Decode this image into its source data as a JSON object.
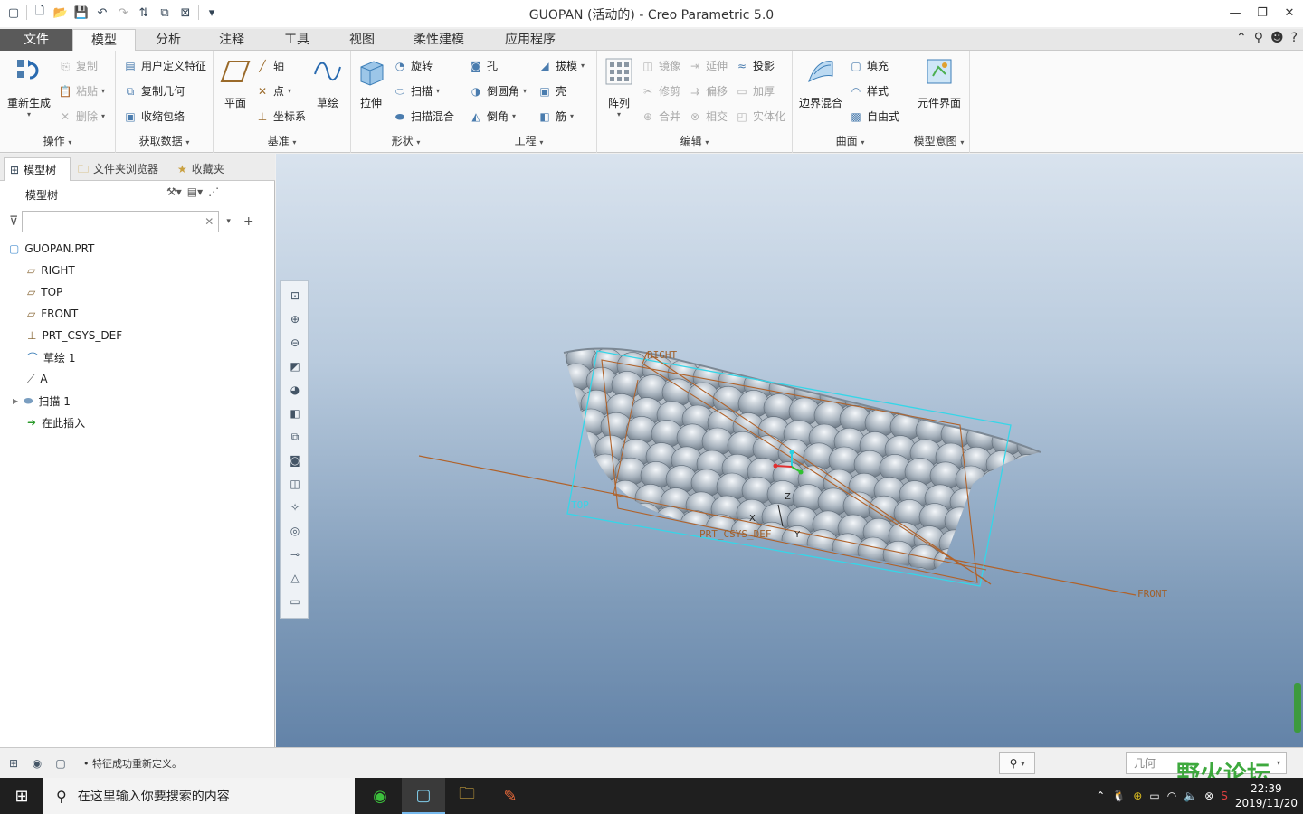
{
  "window": {
    "title": "GUOPAN (活动的) - Creo Parametric 5.0"
  },
  "tabs": [
    "文件",
    "模型",
    "分析",
    "注释",
    "工具",
    "视图",
    "柔性建模",
    "应用程序"
  ],
  "ribbon": {
    "ops": {
      "regen": "重新生成",
      "copy": "复制",
      "paste": "粘贴",
      "delete": "删除",
      "label": "操作"
    },
    "get": {
      "udf": "用户定义特征",
      "copygeom": "复制几何",
      "shrink": "收缩包络",
      "label": "获取数据"
    },
    "datum": {
      "plane": "平面",
      "axis": "轴",
      "point": "点",
      "csys": "坐标系",
      "sketch": "草绘",
      "label": "基准"
    },
    "shape": {
      "extrude": "拉伸",
      "revolve": "旋转",
      "sweep": "扫描",
      "sweepblend": "扫描混合",
      "label": "形状"
    },
    "eng": {
      "hole": "孔",
      "round": "倒圆角",
      "chamfer": "倒角",
      "draft": "拔模",
      "shell": "壳",
      "rib": "筋",
      "label": "工程"
    },
    "edit": {
      "pattern": "阵列",
      "mirror": "镜像",
      "extend": "延伸",
      "project": "投影",
      "trim": "修剪",
      "offset": "偏移",
      "thicken": "加厚",
      "merge": "合并",
      "intersect": "相交",
      "solidify": "实体化",
      "label": "编辑"
    },
    "surface": {
      "boundary": "边界混合",
      "fill": "填充",
      "style": "样式",
      "freeform": "自由式",
      "label": "曲面"
    },
    "intent": {
      "component": "元件界面",
      "label": "模型意图"
    }
  },
  "panel": {
    "tabs": [
      "模型树",
      "文件夹浏览器",
      "收藏夹"
    ],
    "header": "模型树",
    "tree": [
      {
        "label": "GUOPAN.PRT",
        "icon": "part-icon"
      },
      {
        "label": "RIGHT",
        "icon": "datum-plane-icon"
      },
      {
        "label": "TOP",
        "icon": "datum-plane-icon"
      },
      {
        "label": "FRONT",
        "icon": "datum-plane-icon"
      },
      {
        "label": "PRT_CSYS_DEF",
        "icon": "csys-icon"
      },
      {
        "label": "草绘 1",
        "icon": "sketch-icon"
      },
      {
        "label": "A",
        "icon": "axis-csys-icon"
      },
      {
        "label": "扫描 1",
        "icon": "sweep-icon"
      },
      {
        "label": "在此插入",
        "icon": "insert-icon"
      }
    ]
  },
  "viewport": {
    "labels": {
      "right": "RIGHT",
      "top": "TOP",
      "front": "FRONT",
      "csys": "PRT_CSYS_DEF",
      "x": "X",
      "y": "Y",
      "z": "Z"
    }
  },
  "status": {
    "message": "• 特征成功重新定义。",
    "filter": "几何"
  },
  "taskbar": {
    "search": "在这里输入你要搜索的内容",
    "time": "22:39",
    "date": "2019/11/20"
  },
  "watermark": "野火论坛",
  "colors": {
    "fileTab": "#5a5a5a",
    "datum": "#b0622a",
    "selection": "#35d6e8"
  }
}
